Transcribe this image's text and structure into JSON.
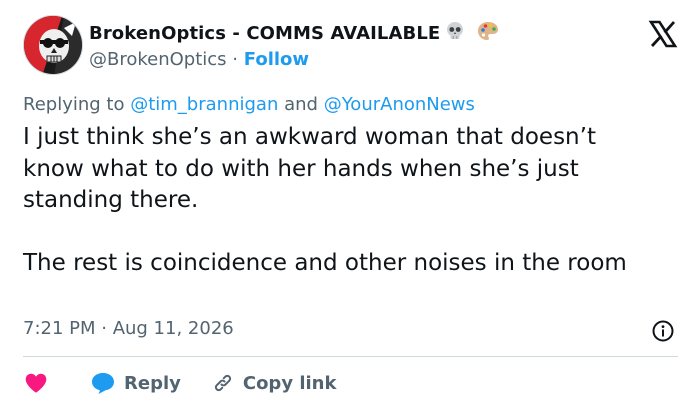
{
  "author": {
    "display_name": "BrokenOptics - COMMS AVAILABLE",
    "emojis": [
      "skull-emoji",
      "artist-palette-emoji"
    ],
    "handle": "@BrokenOptics",
    "separator": "·",
    "follow_label": "Follow"
  },
  "reply_context": {
    "prefix": "Replying to",
    "mention_1": "@tim_brannigan",
    "conjunction": "and",
    "mention_2": "@YourAnonNews"
  },
  "tweet": {
    "text": "I just think she’s an awkward woman that doesn’t know what to do with her hands when she’s just standing there.\n\nThe rest is coincidence and other noises in the room",
    "timestamp": "7:21 PM · Aug 11, 2026"
  },
  "actions": {
    "reply_label": "Reply",
    "copy_link_label": "Copy link"
  },
  "colors": {
    "accent": "#1d9bf0",
    "heart": "#f91880",
    "secondary_text": "#536471",
    "primary_text": "#0f1419",
    "divider": "#cfd9de"
  },
  "icons": [
    "x-logo-icon",
    "info-icon",
    "heart-icon",
    "reply-bubble-icon",
    "link-icon"
  ]
}
